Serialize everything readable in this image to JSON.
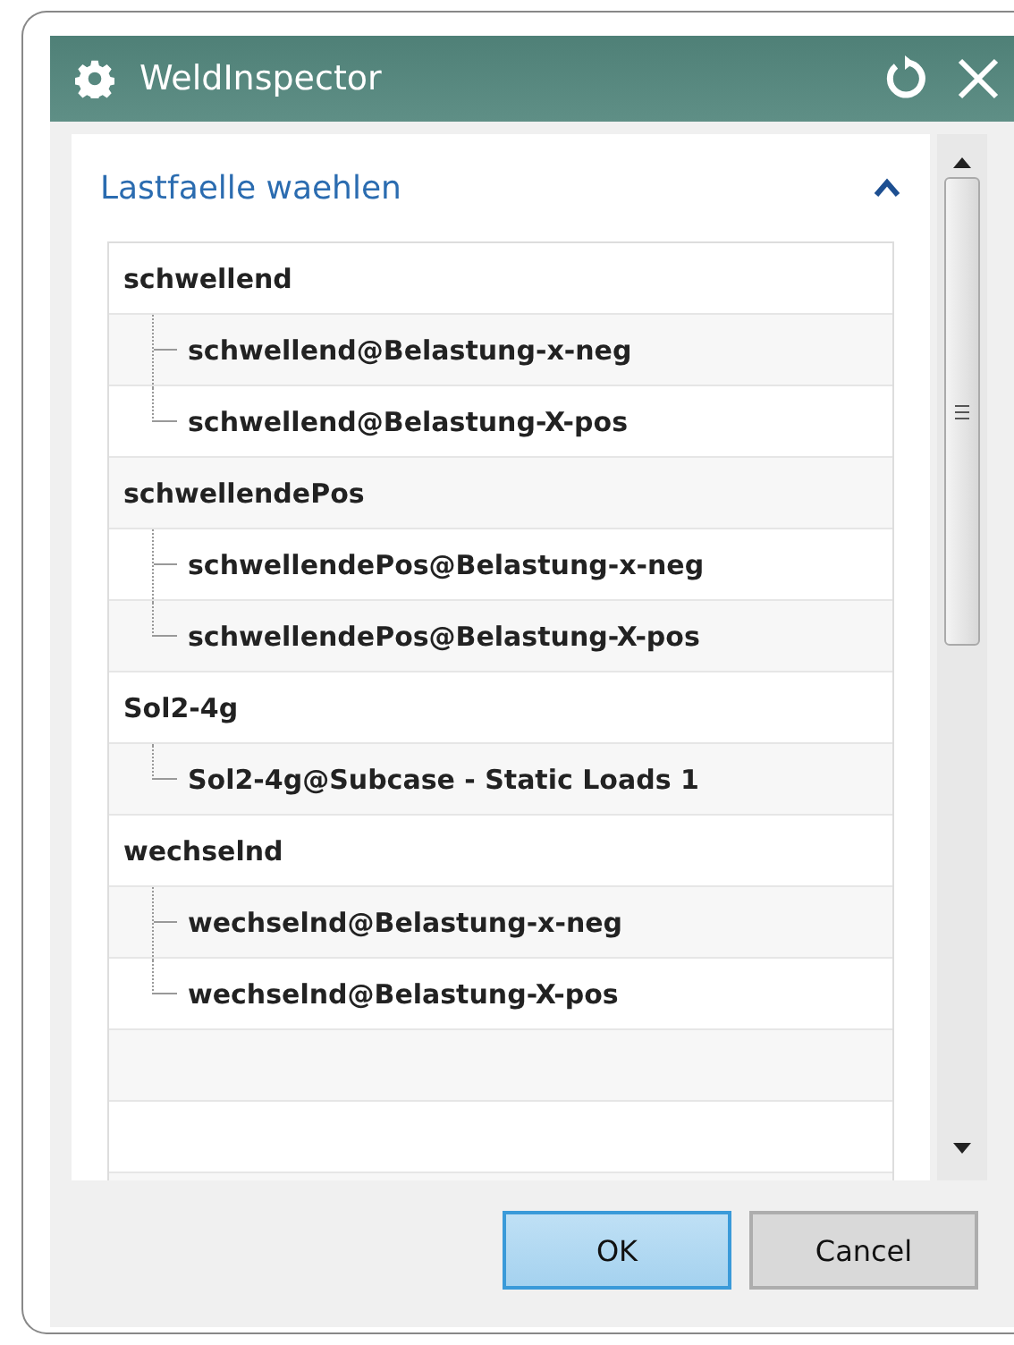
{
  "window": {
    "title": "WeldInspector"
  },
  "section": {
    "title": "Lastfaelle waehlen",
    "expanded": true
  },
  "tree": [
    {
      "label": "schwellend",
      "children": [
        {
          "label": "schwellend@Belastung-x-neg"
        },
        {
          "label": "schwellend@Belastung-X-pos"
        }
      ]
    },
    {
      "label": "schwellendePos",
      "children": [
        {
          "label": "schwellendePos@Belastung-x-neg"
        },
        {
          "label": "schwellendePos@Belastung-X-pos"
        }
      ]
    },
    {
      "label": "Sol2-4g",
      "children": [
        {
          "label": "Sol2-4g@Subcase - Static Loads 1"
        }
      ]
    },
    {
      "label": "wechselnd",
      "children": [
        {
          "label": "wechselnd@Belastung-x-neg"
        },
        {
          "label": "wechselnd@Belastung-X-pos"
        }
      ]
    }
  ],
  "buttons": [
    {
      "label": "OK",
      "default": true
    },
    {
      "label": "Cancel",
      "default": false
    }
  ]
}
